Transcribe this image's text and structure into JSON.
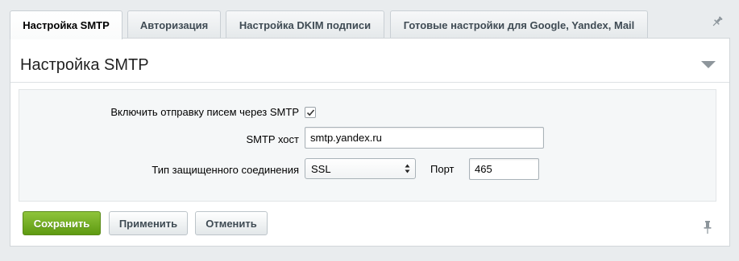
{
  "tabs": [
    {
      "label": "Настройка SMTP",
      "active": true
    },
    {
      "label": "Авторизация",
      "active": false
    },
    {
      "label": "Настройка DKIM подписи",
      "active": false
    },
    {
      "label": "Готовые настройки для Google, Yandex, Mail",
      "active": false
    }
  ],
  "panel": {
    "title": "Настройка SMTP"
  },
  "form": {
    "enable_smtp_label": "Включить отправку писем через SMTP",
    "enable_smtp_checked": true,
    "host_label": "SMTP хост",
    "host_value": "smtp.yandex.ru",
    "security_label": "Тип защищенного соединения",
    "security_value": "SSL",
    "port_label": "Порт",
    "port_value": "465"
  },
  "buttons": {
    "save": "Сохранить",
    "apply": "Применить",
    "cancel": "Отменить"
  },
  "colors": {
    "save_button": "#6faa1f",
    "page_background": "#e9ecee"
  },
  "icons": [
    "pin-icon",
    "collapse-arrow-icon",
    "select-arrows-icon",
    "checkmark-icon"
  ]
}
